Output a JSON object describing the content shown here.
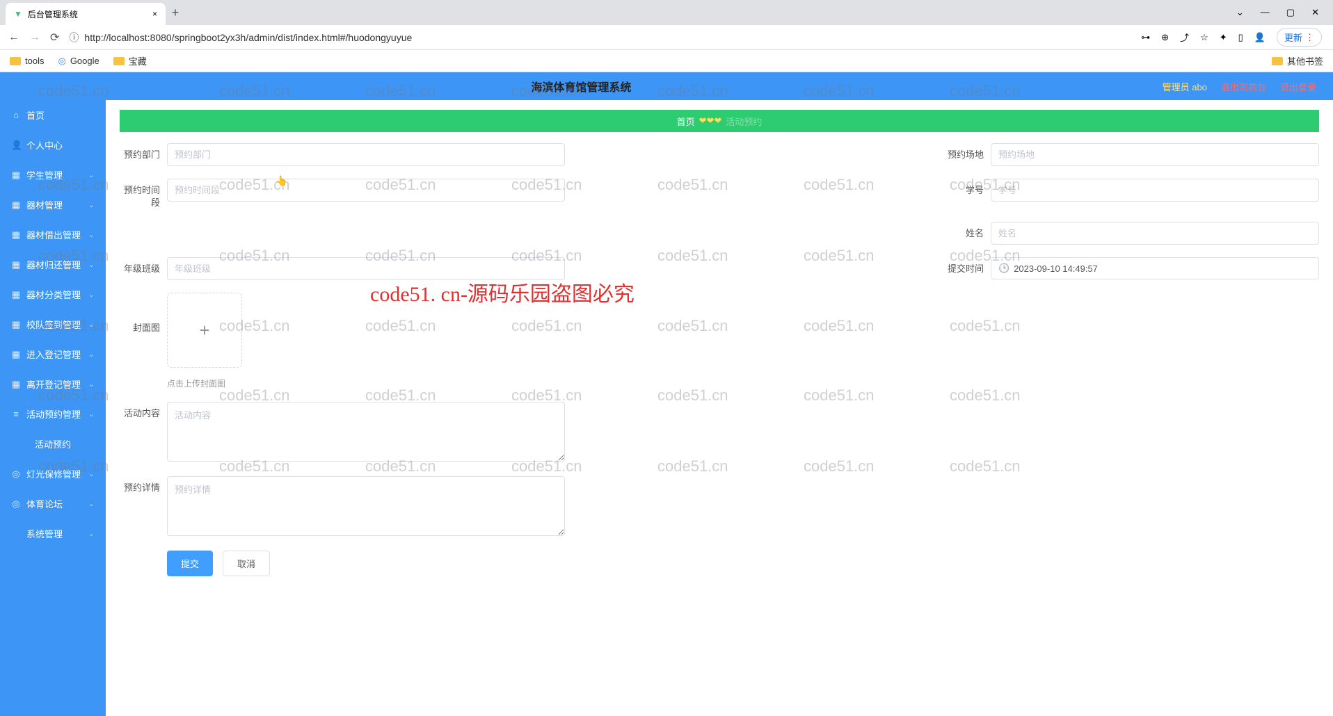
{
  "browser": {
    "tab_title": "后台管理系统",
    "url": "http://localhost:8080/springboot2yx3h/admin/dist/index.html#/huodongyuyue",
    "update_label": "更新",
    "bookmarks": {
      "tools": "tools",
      "google": "Google",
      "treasure": "宝藏",
      "other": "其他书签"
    }
  },
  "header": {
    "title": "海滨体育馆管理系统",
    "user": "管理员 abo",
    "back": "退出到前台",
    "logout": "退出登录"
  },
  "sidebar": {
    "items": [
      {
        "icon": "⌂",
        "label": "首页"
      },
      {
        "icon": "👤",
        "label": "个人中心"
      },
      {
        "icon": "▦",
        "label": "学生管理",
        "exp": true
      },
      {
        "icon": "▦",
        "label": "器材管理",
        "exp": true
      },
      {
        "icon": "▦",
        "label": "器材借出管理",
        "exp": true
      },
      {
        "icon": "▦",
        "label": "器材归还管理",
        "exp": true
      },
      {
        "icon": "▦",
        "label": "器材分类管理",
        "exp": true
      },
      {
        "icon": "▦",
        "label": "校队签到管理",
        "exp": true
      },
      {
        "icon": "▦",
        "label": "进入登记管理",
        "exp": true
      },
      {
        "icon": "▦",
        "label": "离开登记管理",
        "exp": true
      },
      {
        "icon": "≡",
        "label": "活动预约管理",
        "exp": true
      },
      {
        "icon": "",
        "label": "活动预约",
        "sub": true
      },
      {
        "icon": "◎",
        "label": "灯光保修管理",
        "exp": true
      },
      {
        "icon": "◎",
        "label": "体育论坛",
        "exp": true
      },
      {
        "icon": "",
        "label": "系统管理",
        "exp": true
      }
    ]
  },
  "breadcrumb": {
    "home": "首页",
    "sub": "活动预约"
  },
  "form": {
    "dept_label": "预约部门",
    "dept_ph": "预约部门",
    "venue_label": "预约场地",
    "venue_ph": "预约场地",
    "time_label": "预约时间段",
    "time_ph": "预约时间段",
    "sid_label": "学号",
    "sid_ph": "学号",
    "name_label": "姓名",
    "name_ph": "姓名",
    "class_label": "年级班级",
    "class_ph": "年级班级",
    "submittime_label": "提交时间",
    "submittime_val": "2023-09-10 14:49:57",
    "cover_label": "封面图",
    "upload_hint": "点击上传封面图",
    "content_label": "活动内容",
    "content_ph": "活动内容",
    "detail_label": "预约详情",
    "detail_ph": "预约详情",
    "submit": "提交",
    "cancel": "取消"
  },
  "watermark": {
    "text": "code51.cn",
    "big": "code51. cn-源码乐园盗图必究"
  }
}
